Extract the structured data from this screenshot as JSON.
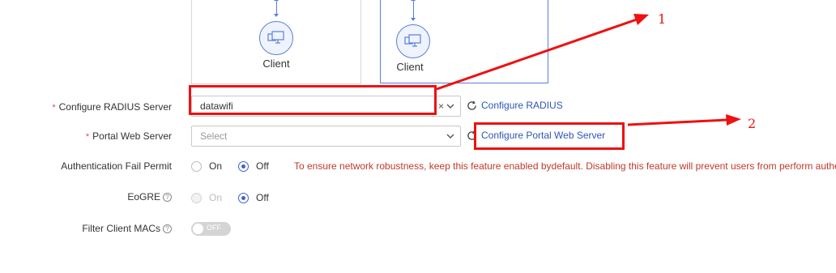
{
  "topology": {
    "clients": [
      {
        "label": "Client",
        "icon": "monitor-icon"
      },
      {
        "label": "Client",
        "icon": "monitor-icon"
      }
    ]
  },
  "form": {
    "radius": {
      "label": "Configure RADIUS Server",
      "required_mark": "*",
      "value": "datawifi",
      "clear_glyph": "×",
      "link": "Configure RADIUS"
    },
    "portal": {
      "label": "Portal Web Server",
      "required_mark": "*",
      "placeholder": "Select",
      "link": "Configure Portal Web Server"
    },
    "auth_fail": {
      "label": "Authentication Fail Permit",
      "options": [
        "On",
        "Off"
      ],
      "selected": "Off",
      "warning": "To ensure network robustness, keep this feature enabled bydefault. Disabling this feature will prevent users from perform authentication"
    },
    "eogre": {
      "label": "EoGRE",
      "help": "?",
      "options": [
        "On",
        "Off"
      ],
      "selected": "Off",
      "on_disabled": true
    },
    "filter_macs": {
      "label": "Filter Client MACs",
      "help": "?",
      "toggle_text": "OFF"
    }
  },
  "annotations": {
    "marker_1": "1",
    "marker_2": "2",
    "color": "#ee1111"
  },
  "colors": {
    "accent": "#3f63c9",
    "link": "#2e55b7",
    "warning": "#c0392b",
    "required": "#e84a4a"
  }
}
